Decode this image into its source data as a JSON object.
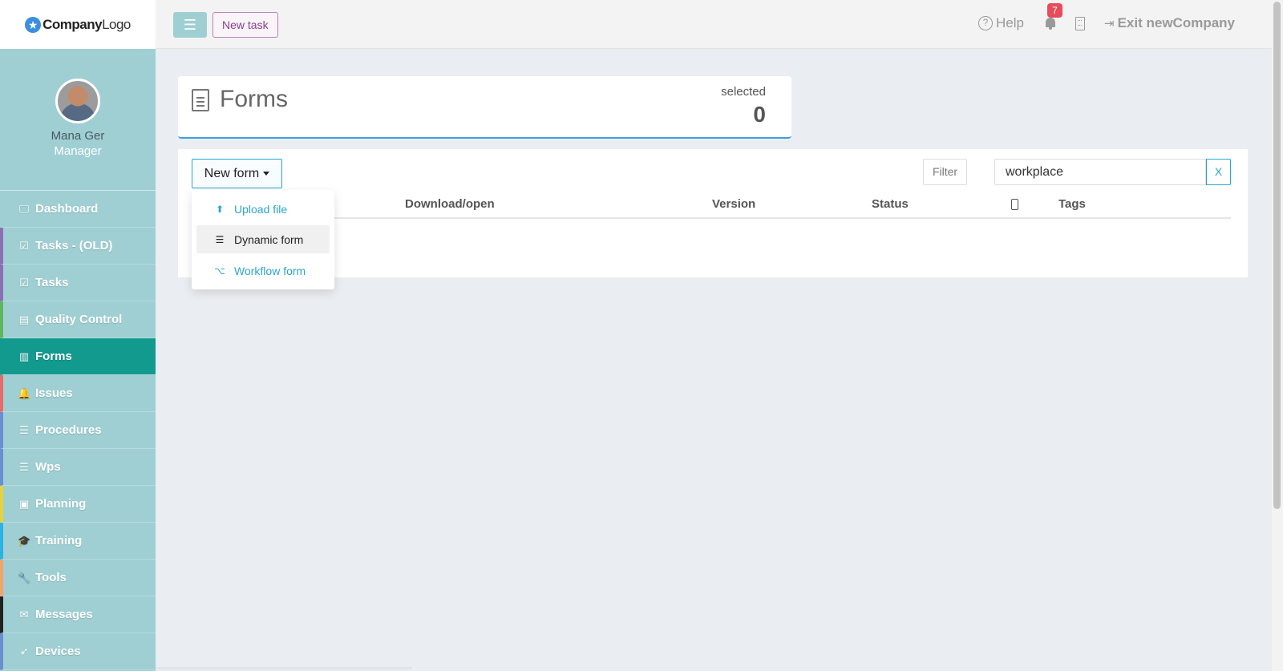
{
  "logo": {
    "bold": "Company",
    "rest": "Logo"
  },
  "profile": {
    "name": "Mana Ger",
    "role": "Manager"
  },
  "nav": [
    {
      "label": "Dashboard",
      "icon": "monitor-icon",
      "glyph": "🖵",
      "accent": "#9fcfd3"
    },
    {
      "label": "Tasks - (OLD)",
      "icon": "check-square-icon",
      "glyph": "☑",
      "accent": "#8b6fb5"
    },
    {
      "label": "Tasks",
      "icon": "check-square-icon",
      "glyph": "☑",
      "accent": "#8b6fb5"
    },
    {
      "label": "Quality Control",
      "icon": "book-icon",
      "glyph": "▤",
      "accent": "#5cb85c"
    },
    {
      "label": "Forms",
      "icon": "file-text-icon",
      "glyph": "▥",
      "accent": "#139a8f",
      "active": true
    },
    {
      "label": "Issues",
      "icon": "bell-icon",
      "glyph": "🔔",
      "accent": "#e86a6a"
    },
    {
      "label": "Procedures",
      "icon": "list-icon",
      "glyph": "☰",
      "accent": "#6a8fd1"
    },
    {
      "label": "Wps",
      "icon": "list-icon",
      "glyph": "☰",
      "accent": "#6a8fd1"
    },
    {
      "label": "Planning",
      "icon": "calendar-check-icon",
      "glyph": "▣",
      "accent": "#e7d23c"
    },
    {
      "label": "Training",
      "icon": "graduation-cap-icon",
      "glyph": "🎓",
      "accent": "#2bb3e3"
    },
    {
      "label": "Tools",
      "icon": "wrench-icon",
      "glyph": "🔧",
      "accent": "#f0a56a"
    },
    {
      "label": "Messages",
      "icon": "envelope-icon",
      "glyph": "✉",
      "accent": "#222222"
    },
    {
      "label": "Devices",
      "icon": "rocket-icon",
      "glyph": "➶",
      "accent": "#6a8fd1"
    }
  ],
  "topbar": {
    "menu_icon": "hamburger-icon",
    "new_task": "New task",
    "help": "Help",
    "notifications": "7",
    "exit": "Exit newCompany"
  },
  "header": {
    "title": "Forms",
    "selected_label": "selected",
    "selected_count": "0"
  },
  "toolbar": {
    "new_form": "New form",
    "filter": "Filter",
    "search_value": "workplace",
    "clear": "X"
  },
  "columns": [
    "Download/open",
    "Version",
    "Status",
    "Tags"
  ],
  "dropdown": [
    {
      "label": "Upload file",
      "icon": "upload-icon",
      "glyph": "⬆"
    },
    {
      "label": "Dynamic form",
      "icon": "list-icon",
      "glyph": "☰",
      "hover": true
    },
    {
      "label": "Workflow form",
      "icon": "workflow-icon",
      "glyph": "⌥"
    }
  ],
  "colors": {
    "accent": "#2ba6cb",
    "sidebar": "#9fcfd3",
    "active": "#139a8f",
    "purple": "#8e3d93",
    "badge": "#e74c5b"
  }
}
